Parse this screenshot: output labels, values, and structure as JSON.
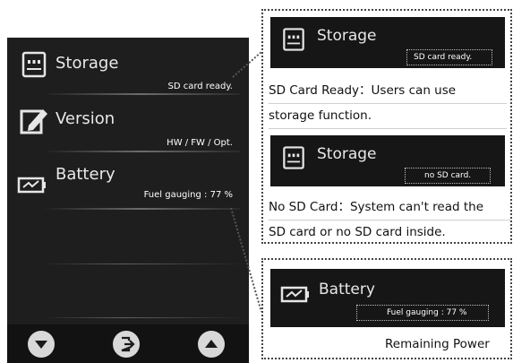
{
  "device": {
    "menu": [
      {
        "title": "Storage",
        "subtitle": "SD card ready.",
        "icon": "sd-card-icon"
      },
      {
        "title": "Version",
        "subtitle": "HW / FW / Opt.",
        "icon": "edit-document-icon"
      },
      {
        "title": "Battery",
        "subtitle": "Fuel gauging : 77 %",
        "icon": "battery-icon"
      }
    ],
    "nav": [
      "chevron-down-icon",
      "exit-icon",
      "chevron-up-icon"
    ]
  },
  "callouts": {
    "storage_ready": {
      "title": "Storage",
      "subtitle": "SD card ready.",
      "desc_lines": [
        "SD Card Ready：Users can use",
        "storage function."
      ]
    },
    "storage_none": {
      "title": "Storage",
      "subtitle": "no SD card.",
      "desc_lines": [
        "No SD Card：System can't read  the",
        "SD card or no SD card inside."
      ]
    },
    "battery": {
      "title": "Battery",
      "subtitle": "Fuel gauging : 77 %",
      "desc_lines": [
        "Remaining Power"
      ]
    }
  }
}
